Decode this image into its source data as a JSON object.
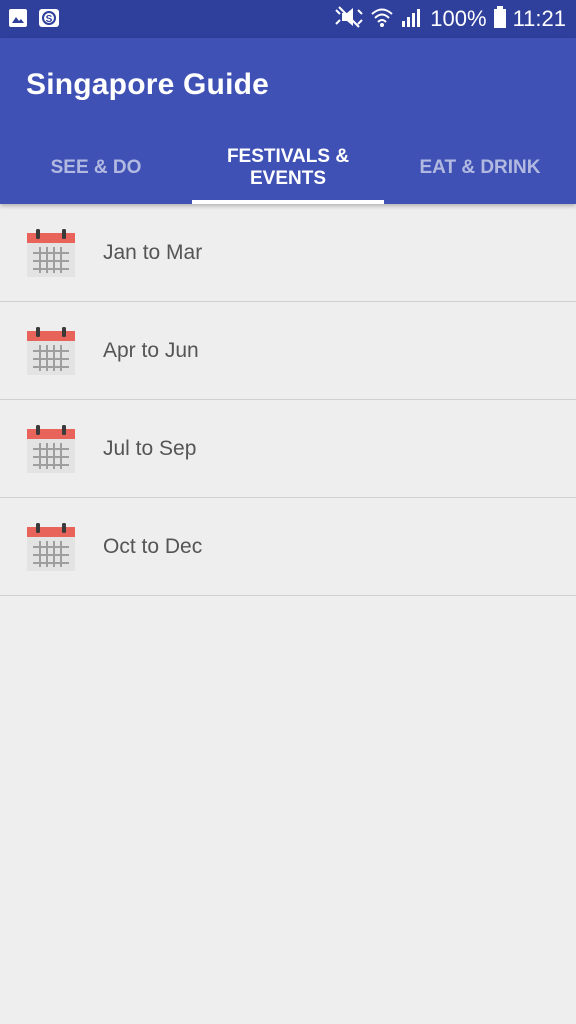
{
  "status_bar": {
    "battery_text": "100%",
    "time": "11:21",
    "icons": [
      "image-notification-icon",
      "app-notification-icon",
      "mute-icon",
      "wifi-icon",
      "signal-icon",
      "battery-icon"
    ]
  },
  "app": {
    "title": "Singapore Guide"
  },
  "tabs": [
    {
      "label": "SEE & DO",
      "active": false
    },
    {
      "label": "FESTIVALS & EVENTS",
      "active": true
    },
    {
      "label": "EAT & DRINK",
      "active": false
    }
  ],
  "list": {
    "items": [
      {
        "label": "Jan to Mar",
        "icon": "calendar-icon"
      },
      {
        "label": "Apr to Jun",
        "icon": "calendar-icon"
      },
      {
        "label": "Jul to Sep",
        "icon": "calendar-icon"
      },
      {
        "label": "Oct to Dec",
        "icon": "calendar-icon"
      }
    ]
  },
  "colors": {
    "status_bar": "#2f3f9c",
    "app_bar": "#3f51b5",
    "background": "#eeeeee",
    "calendar_red": "#e8635a",
    "calendar_body": "#e3e3e3"
  }
}
